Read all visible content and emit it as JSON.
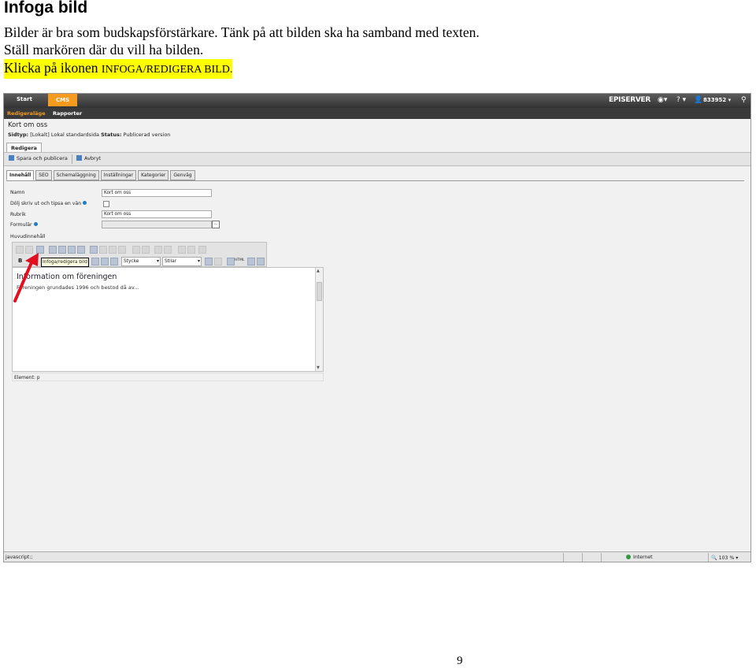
{
  "document": {
    "title": "Infoga bild",
    "para1": "Bilder är bra som budskapsförstärkare. Tänk på att bilden ska ha samband med texten.",
    "para2": "Ställ markören där du vill ha bilden.",
    "para3_prefix": "Klicka på ikonen ",
    "para3_code": "INFOGA/REDIGERA BILD.",
    "page_number": "9"
  },
  "screenshot": {
    "topbar": {
      "start": "Start",
      "cms": "CMS",
      "logo": "EPISERVER",
      "user": "833952",
      "help": "?"
    },
    "subbar": {
      "edit_mode": "Redigeraläge",
      "reports": "Rapporter"
    },
    "page_title": "Kort om oss",
    "page_info_label1": "Sidtyp:",
    "page_info_value1": "[Lokalt] Lokal standardsida",
    "page_info_label2": "Status:",
    "page_info_value2": "Publicerad version",
    "edit_tab": "Redigera",
    "actions": {
      "save": "Spara och publicera",
      "cancel": "Avbryt"
    },
    "tabs": [
      "Innehåll",
      "SEO",
      "Schemaläggning",
      "Inställningar",
      "Kategorier",
      "Genväg"
    ],
    "fields": {
      "namn_label": "Namn",
      "namn_value": "Kort om oss",
      "hide_label": "Dölj skriv ut och tipsa en vän",
      "rubrik_label": "Rubrik",
      "rubrik_value": "Kort om oss",
      "formular_label": "Formulär",
      "formular_button": "...",
      "main_content_label": "Huvudinnehåll"
    },
    "toolbar": {
      "bold": "B",
      "italic": "I",
      "tooltip": "Infoga/redigera bild",
      "style_select": "Stycke",
      "styles_select": "Stilar",
      "html": "HTML"
    },
    "editor": {
      "heading": "Information om föreningen",
      "text": "Föreningen grundades 1996 och bestod då av..."
    },
    "element_path": "Element: p",
    "statusbar": {
      "left": "javascript:;",
      "zone": "Internet",
      "zoom": "103 %"
    },
    "colors": {
      "accent": "#f59b1e",
      "arrow": "#e01020",
      "tooltip_bg": "#ffffe1"
    }
  }
}
